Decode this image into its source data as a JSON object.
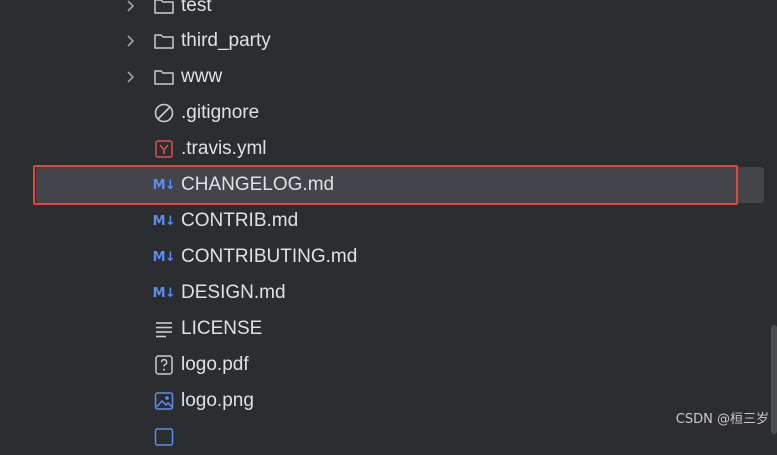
{
  "file_tree": {
    "items": [
      {
        "label": "test",
        "type": "folder",
        "icon": "folder-icon"
      },
      {
        "label": "third_party",
        "type": "folder",
        "icon": "folder-icon"
      },
      {
        "label": "www",
        "type": "folder",
        "icon": "folder-icon"
      },
      {
        "label": ".gitignore",
        "type": "file",
        "icon": "ignore-icon"
      },
      {
        "label": ".travis.yml",
        "type": "file",
        "icon": "yaml-icon"
      },
      {
        "label": "CHANGELOG.md",
        "type": "file",
        "icon": "markdown-icon",
        "selected": true
      },
      {
        "label": "CONTRIB.md",
        "type": "file",
        "icon": "markdown-icon"
      },
      {
        "label": "CONTRIBUTING.md",
        "type": "file",
        "icon": "markdown-icon"
      },
      {
        "label": "DESIGN.md",
        "type": "file",
        "icon": "markdown-icon"
      },
      {
        "label": "LICENSE",
        "type": "file",
        "icon": "text-file-icon"
      },
      {
        "label": "logo.pdf",
        "type": "file",
        "icon": "unknown-file-icon"
      },
      {
        "label": "logo.png",
        "type": "file",
        "icon": "image-file-icon"
      }
    ],
    "markdown_icon_text": "M↓"
  },
  "colors": {
    "background": "#2b2d30",
    "selected_row": "#43454a",
    "highlight_border": "#e0493a",
    "text": "#dfe1e5",
    "markdown_blue": "#5a8dee",
    "yaml_red": "#d9534f"
  },
  "watermark": "CSDN @桓三岁"
}
